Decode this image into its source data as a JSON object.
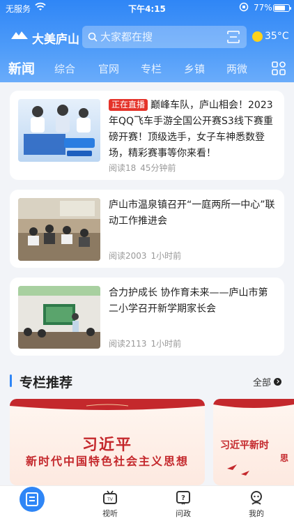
{
  "status_bar": {
    "carrier": "无服务",
    "time": "下午4:15",
    "battery": "77%"
  },
  "header": {
    "app_name": "大美庐山",
    "search_placeholder": "大家都在搜",
    "temperature": "35°C"
  },
  "tabs": [
    {
      "label": "新闻",
      "active": true
    },
    {
      "label": "综合"
    },
    {
      "label": "官网"
    },
    {
      "label": "专栏"
    },
    {
      "label": "乡镇"
    },
    {
      "label": "两微"
    }
  ],
  "news": [
    {
      "badge": "正在直播",
      "title": "巅峰车队，庐山相会！2023年QQ飞车手游全国公开赛S3线下赛重磅开赛！顶级选手，女子车神悉数登场，精彩赛事等你来看！",
      "reads": "阅读18",
      "time": "45分钟前"
    },
    {
      "title": "庐山市温泉镇召开“一庭两所一中心”联动工作推进会",
      "reads": "阅读2003",
      "time": "1小时前"
    },
    {
      "title": "合力护成长 协作育未来——庐山市第二小学召开新学期家长会",
      "reads": "阅读2113",
      "time": "1小时前"
    }
  ],
  "section": {
    "title": "专栏推荐",
    "more": "全部"
  },
  "features": [
    {
      "line1": "习近平",
      "line2": "新时代中国特色社会主义思想"
    },
    {
      "line1": "习近平新时",
      "line2": "思"
    }
  ],
  "bottom_nav": [
    {
      "label": "视听",
      "icon": "tv-icon"
    },
    {
      "label": "问政",
      "icon": "question-icon"
    },
    {
      "label": "我的",
      "icon": "user-icon"
    }
  ],
  "colors": {
    "brand": "#2f86f6",
    "live_badge": "#e5332a",
    "feature_red": "#c4282c"
  }
}
